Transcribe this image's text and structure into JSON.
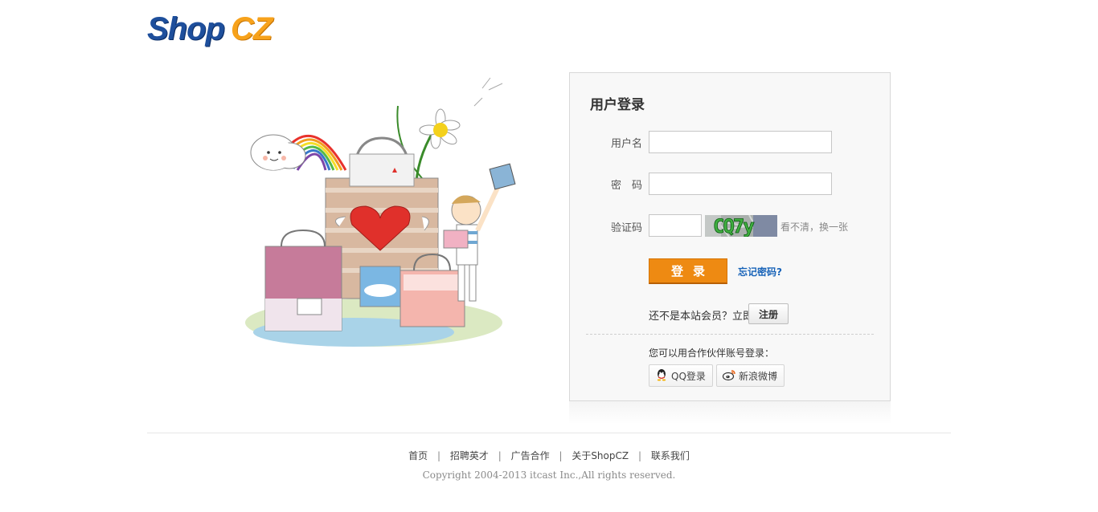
{
  "logo": {
    "part1": "Shop",
    "part2": "CZ"
  },
  "login": {
    "title": "用户登录",
    "username_label": "用户名",
    "username_value": "",
    "password_label": "密　码",
    "password_value": "",
    "captcha_label": "验证码",
    "captcha_value": "",
    "captcha_text": "CQ7y",
    "captcha_refresh": "看不清，换一张",
    "submit_label": "登录",
    "forgot_label": "忘记密码?",
    "register_prompt": "还不是本站会员？立即",
    "register_label": "注册",
    "partner_prompt": "您可以用合作伙伴账号登录：",
    "qq_label": "QQ登录",
    "weibo_label": "新浪微博"
  },
  "footer": {
    "links": [
      "首页",
      "招聘英才",
      "广告合作",
      "关于ShopCZ",
      "联系我们"
    ],
    "separator": "|",
    "copyright": "Copyright 2004-2013 itcast Inc.,All rights reserved."
  },
  "colors": {
    "logo_blue": "#1e4f9c",
    "logo_orange": "#f7a21b",
    "login_button": "#ee8a12",
    "link_blue": "#1863b8"
  }
}
